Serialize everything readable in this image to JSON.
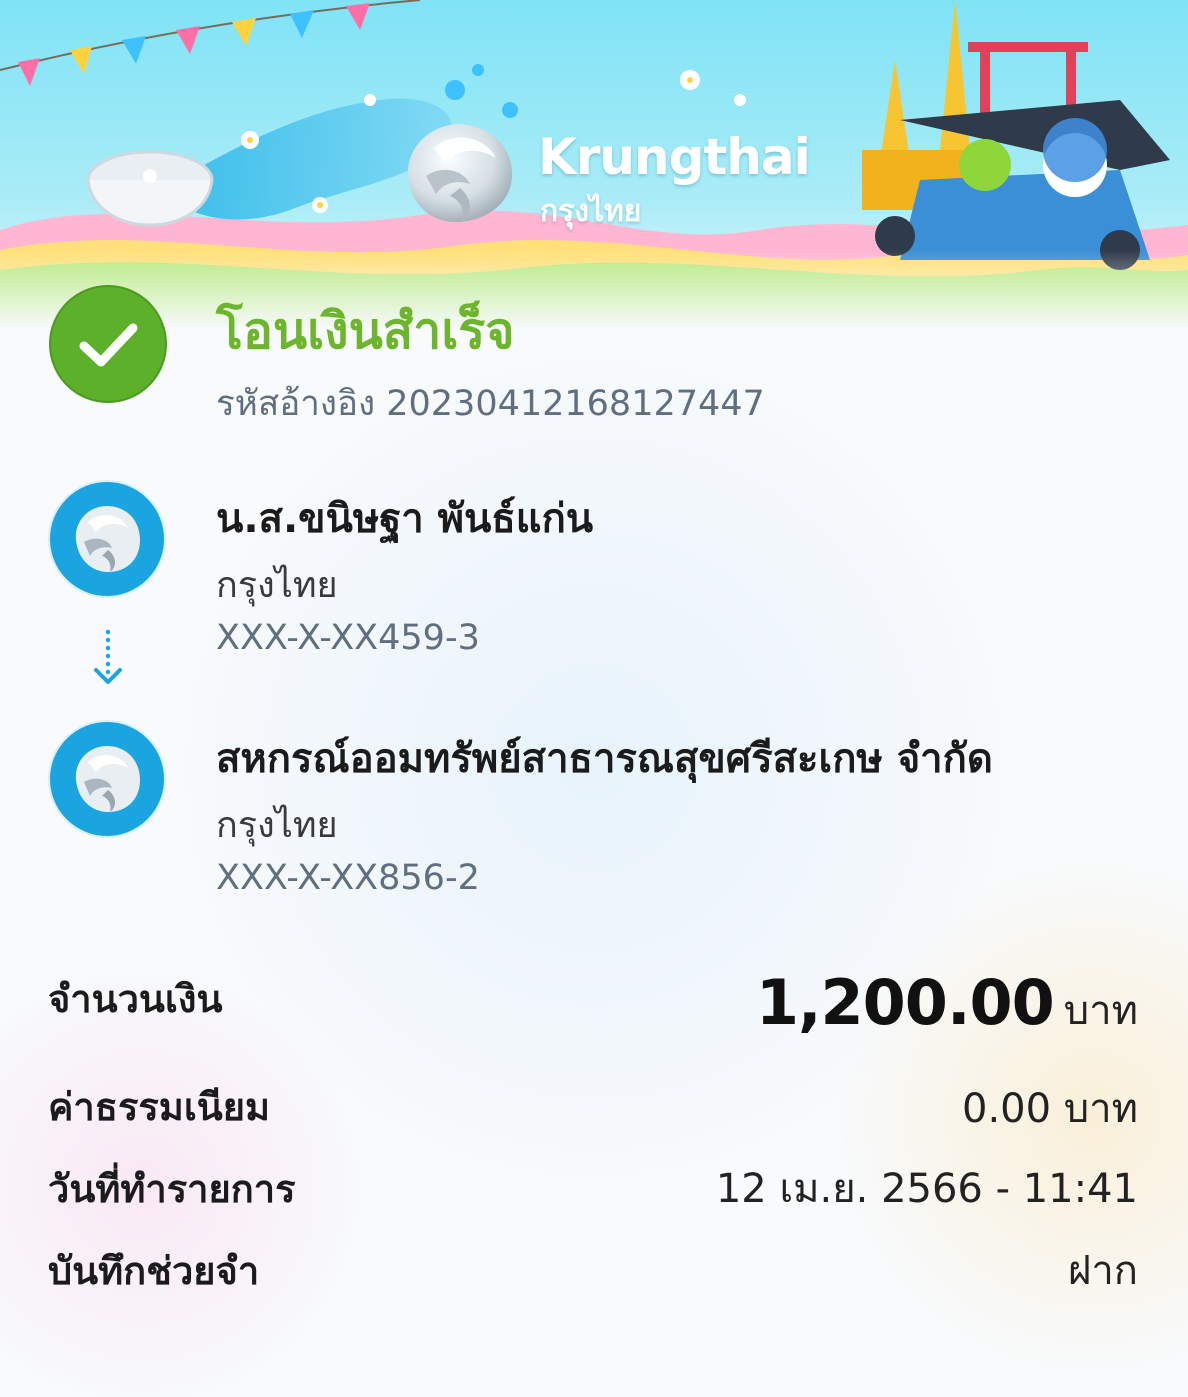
{
  "brand": {
    "name_en": "Krungthai",
    "name_th": "กรุงไทย"
  },
  "status": {
    "title": "โอนเงินสำเร็จ",
    "reference_label": "รหัสอ้างอิง",
    "reference_code": "2023041216812744​7",
    "icon": "check-circle-icon"
  },
  "sender": {
    "name": "น.ส.ขนิษฐา พันธ์แก่น",
    "bank": "กรุงไทย",
    "account": "XXX-X-XX459-3",
    "icon": "krungthai-bird-icon"
  },
  "receiver": {
    "name": "สหกรณ์ออมทรัพย์สาธารณสุขศรีสะเกษ จำกัด",
    "bank": "กรุงไทย",
    "account": "XXX-X-XX856-2",
    "icon": "krungthai-bird-icon"
  },
  "details": {
    "amount_label": "จำนวนเงิน",
    "amount_value": "1,200.00",
    "amount_unit": "บาท",
    "fee_label": "ค่าธรรมเนียม",
    "fee_value": "0.00 บาท",
    "date_label": "วันที่ทำรายการ",
    "date_value": "12 เม.ย. 2566 - 11:41",
    "memo_label": "บันทึกช่วยจำ",
    "memo_value": "ฝาก"
  },
  "colors": {
    "success_green": "#6cb52d",
    "brand_blue": "#1ba5e0",
    "muted_text": "#5f6f80"
  }
}
